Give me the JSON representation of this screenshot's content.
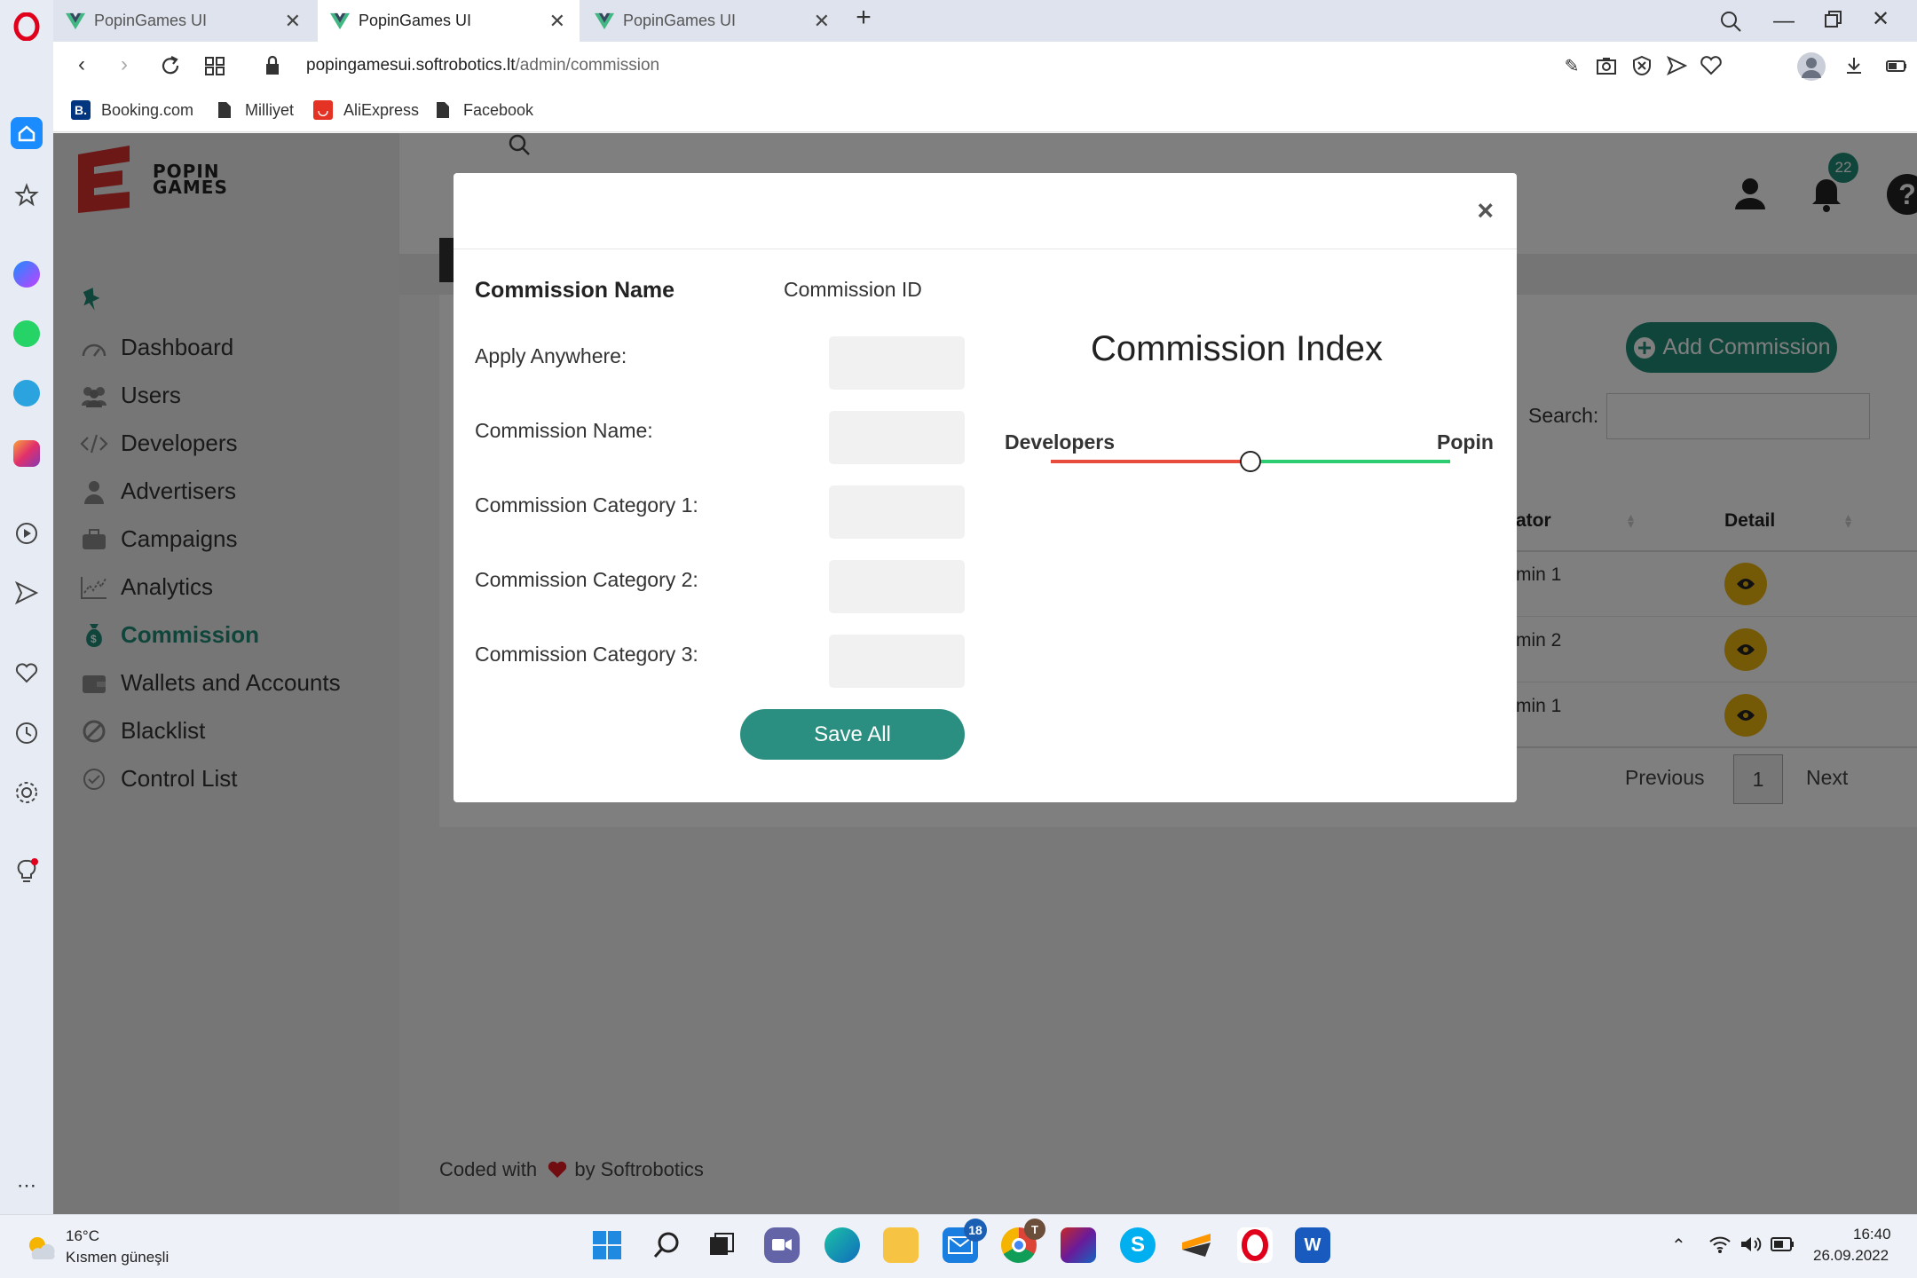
{
  "browser": {
    "tabs": [
      {
        "title": "PopinGames UI"
      },
      {
        "title": "PopinGames UI"
      },
      {
        "title": "PopinGames UI"
      }
    ],
    "url": {
      "domain": "popingamesui.softrobotics.lt",
      "path": "/admin/commission"
    },
    "bookmarks": [
      {
        "label": "Booking.com"
      },
      {
        "label": "Milliyet"
      },
      {
        "label": "AliExpress"
      },
      {
        "label": "Facebook"
      }
    ]
  },
  "app": {
    "logo": {
      "line1": "POPIN",
      "line2": "GAMES"
    },
    "notifications_count": "22",
    "sidebar": {
      "items": [
        {
          "label": "Dashboard"
        },
        {
          "label": "Users"
        },
        {
          "label": "Developers"
        },
        {
          "label": "Advertisers"
        },
        {
          "label": "Campaigns"
        },
        {
          "label": "Analytics"
        },
        {
          "label": "Commission"
        },
        {
          "label": "Wallets and Accounts"
        },
        {
          "label": "Blacklist"
        },
        {
          "label": "Control List"
        }
      ],
      "active": "Commission"
    },
    "main": {
      "add_button": "Add Commission",
      "search_label": "Search:",
      "table": {
        "headers": [
          "ator",
          "Detail"
        ],
        "rows": [
          {
            "creator": "min 1"
          },
          {
            "creator": "min 2"
          },
          {
            "creator": "min 1"
          }
        ]
      },
      "pagination": {
        "previous": "Previous",
        "current": "1",
        "next": "Next"
      }
    },
    "footer": {
      "prefix": "Coded with",
      "suffix": "by Softrobotics"
    }
  },
  "modal": {
    "header_name": "Commission Name",
    "header_id": "Commission ID",
    "fields": [
      {
        "label": "Apply Anywhere:",
        "value": ""
      },
      {
        "label": "Commission Name:",
        "value": ""
      },
      {
        "label": "Commission Category 1:",
        "value": ""
      },
      {
        "label": "Commission Category 2:",
        "value": ""
      },
      {
        "label": "Commission Category 3:",
        "value": ""
      }
    ],
    "save_label": "Save All",
    "index": {
      "title": "Commission Index",
      "left_label": "Developers",
      "right_label": "Popin",
      "value": 0.5,
      "left_color": "#e74c3c",
      "right_color": "#2ecc71"
    }
  },
  "taskbar": {
    "weather": {
      "temp": "16°C",
      "desc": "Kısmen güneşli"
    },
    "mail_badge": "18",
    "chrome_badge": "T",
    "time": "16:40",
    "date": "26.09.2022"
  },
  "colors": {
    "accent": "#218a76",
    "eye_button": "#e8b20e",
    "logo_red": "#d9302f"
  }
}
